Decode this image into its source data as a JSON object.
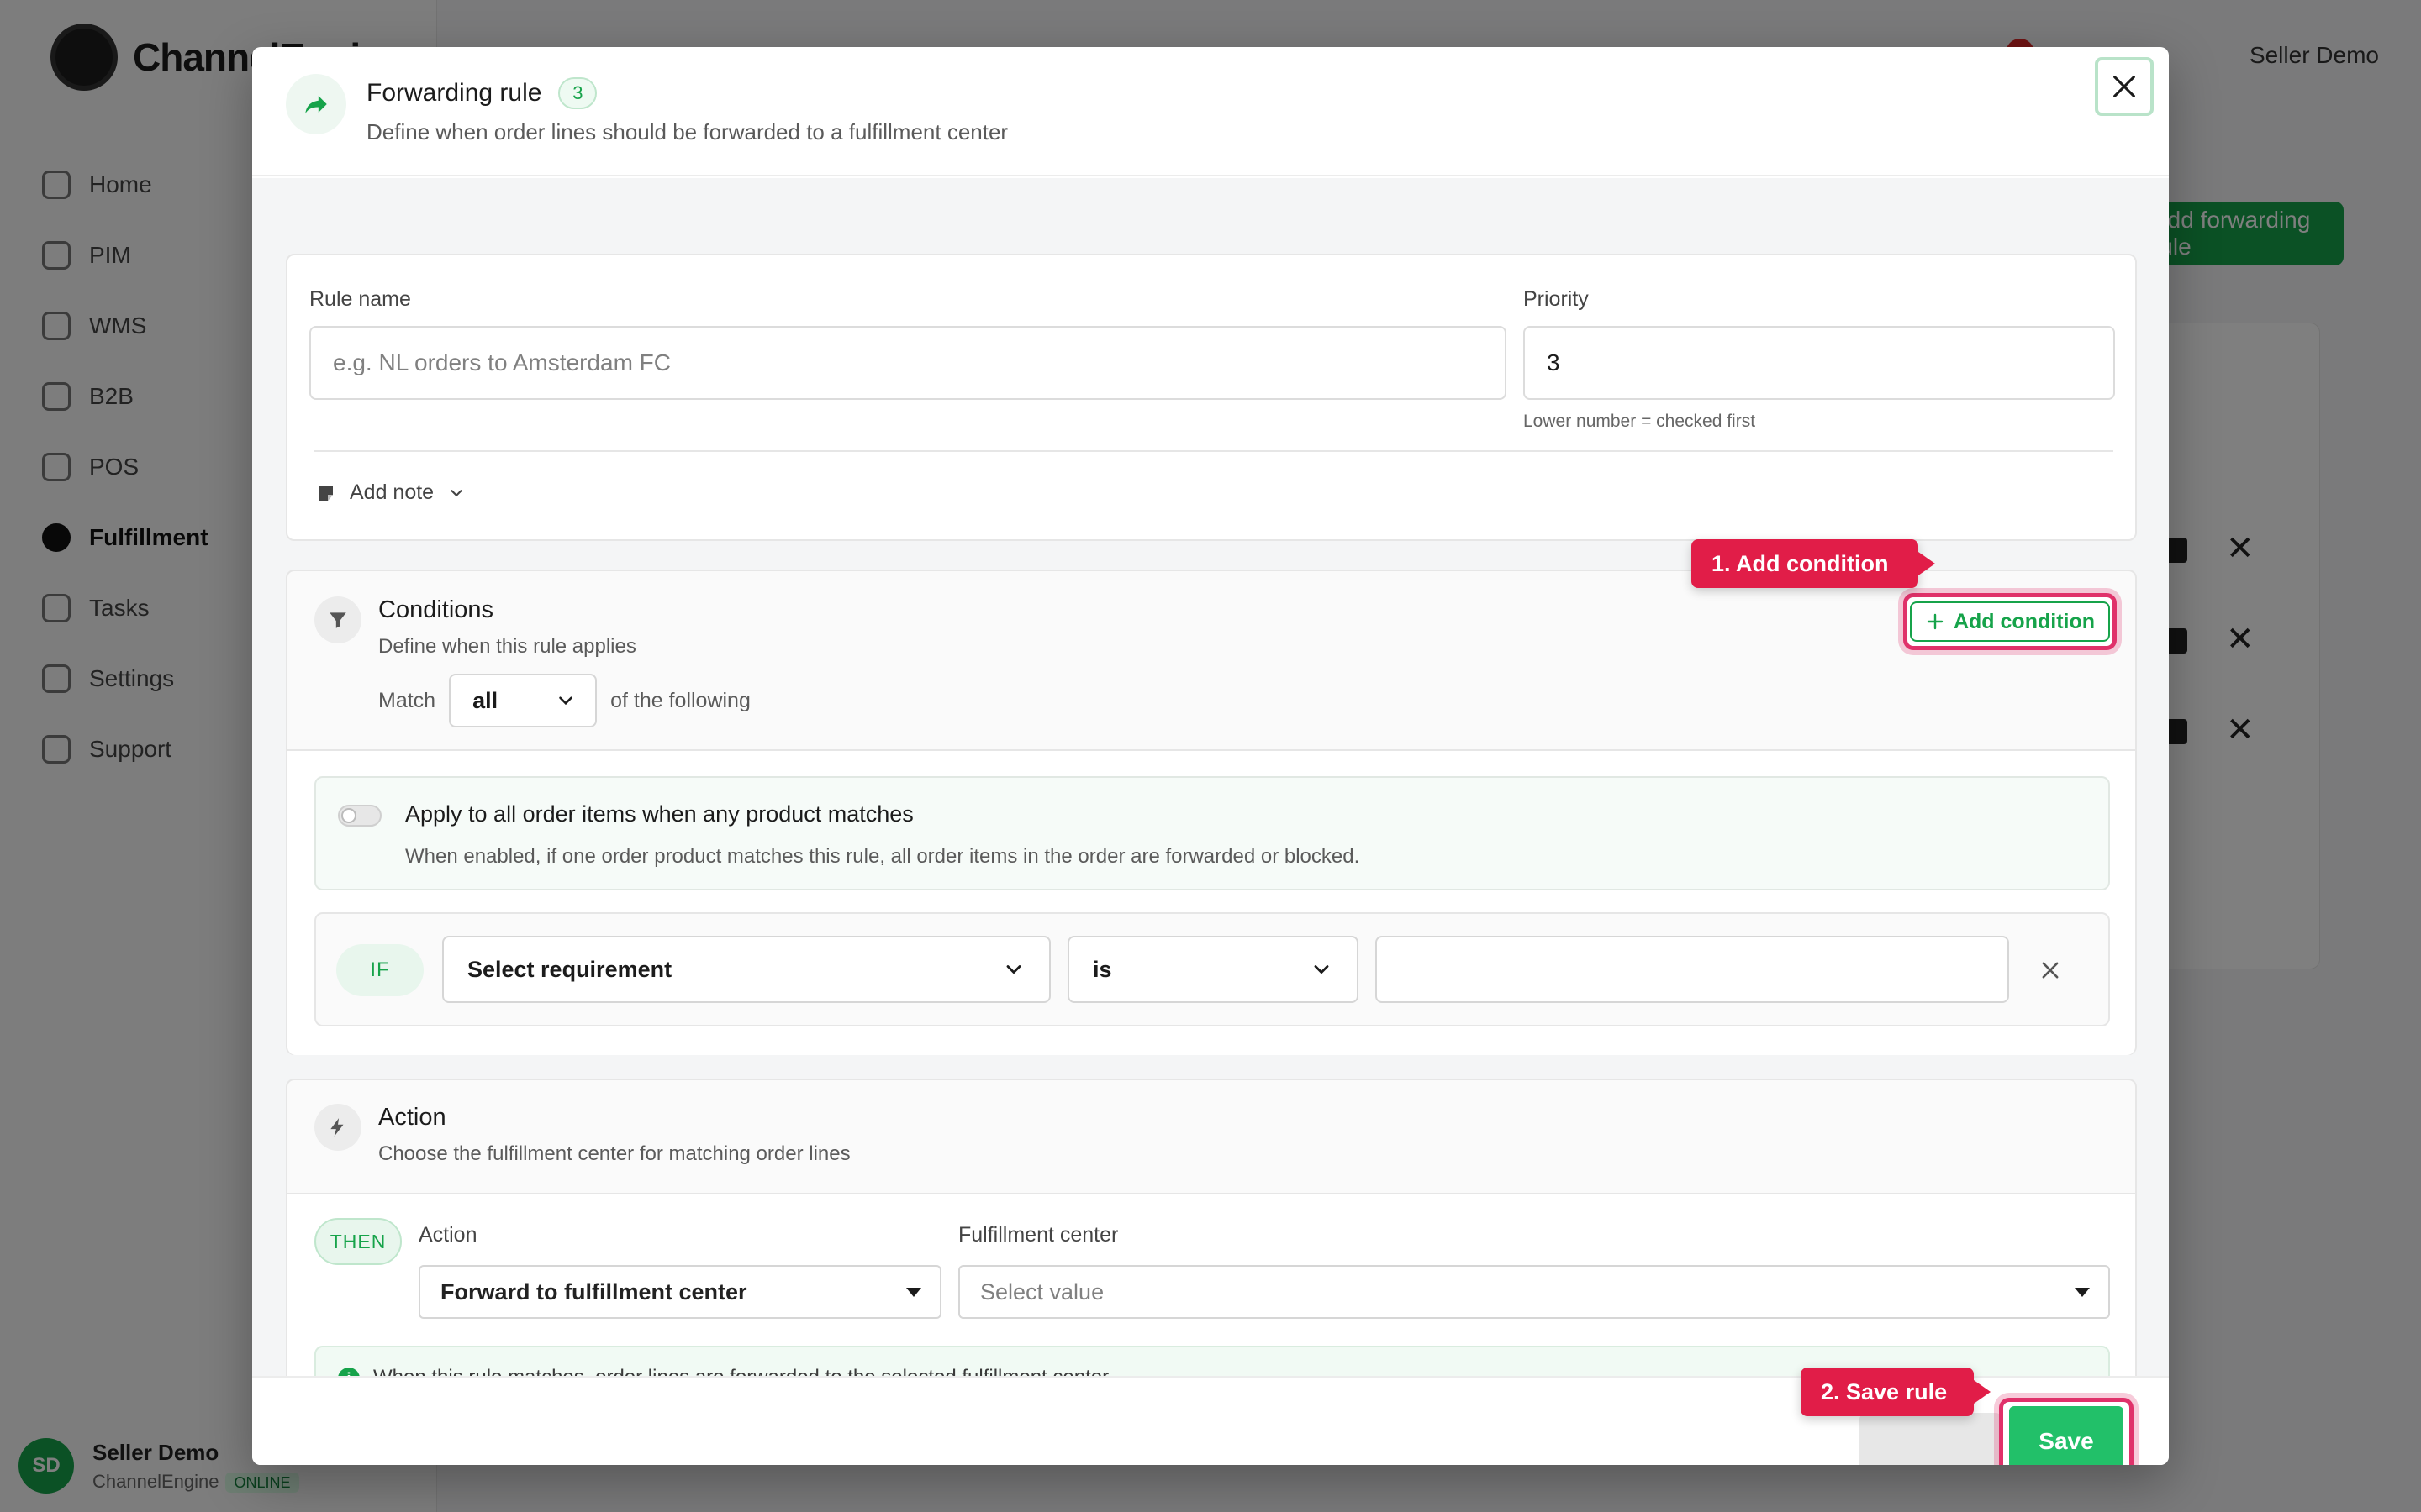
{
  "background": {
    "logo_text": "ChannelEngine",
    "nav_items": [
      {
        "label": "Home"
      },
      {
        "label": "PIM"
      },
      {
        "label": "WMS"
      },
      {
        "label": "B2B"
      },
      {
        "label": "POS"
      },
      {
        "label": "Fulfillment"
      },
      {
        "label": "Tasks"
      },
      {
        "label": "Settings"
      },
      {
        "label": "Support"
      }
    ],
    "top_user": "Seller Demo",
    "new_button": "Add forwarding rule",
    "user_initials": "SD",
    "user_name": "Seller Demo",
    "user_org": "ChannelEngine",
    "user_badge": "ONLINE"
  },
  "modal": {
    "title": "Forwarding rule",
    "count": "3",
    "subtitle": "Define when order lines should be forwarded to a fulfillment center",
    "rule_name_label": "Rule name",
    "rule_name_placeholder": "e.g. NL orders to Amsterdam FC",
    "priority_label": "Priority",
    "priority_value": "3",
    "priority_hint": "Lower number = checked first",
    "add_note_label": "Add note",
    "conditions": {
      "title": "Conditions",
      "description": "Define when this rule applies",
      "match_label": "Match",
      "match_value": "all",
      "match_suffix": "of the following",
      "add_condition_label": "Add condition",
      "apply_all_title": "Apply to all order items when any product matches",
      "apply_all_desc": "When enabled, if one order product matches this rule, all order items in the order are forwarded or blocked.",
      "if_label": "IF",
      "requirement_value": "Select requirement",
      "operator_value": "is",
      "condition_value": ""
    },
    "action": {
      "title": "Action",
      "description": "Choose the fulfillment center for matching order lines",
      "then_label": "THEN",
      "action_label": "Action",
      "action_value": "Forward to fulfillment center",
      "fc_label": "Fulfillment center",
      "fc_placeholder": "Select value",
      "info_text": "When this rule matches, order lines are forwarded to the selected fulfillment center."
    },
    "save_label": "Save"
  },
  "callouts": {
    "step1": "1. Add condition",
    "step2": "2. Save rule"
  },
  "colors": {
    "accent": "#16a34a",
    "save_green": "#22c069",
    "callout_red": "#e11d48",
    "highlight_ring": "#e0316a"
  }
}
